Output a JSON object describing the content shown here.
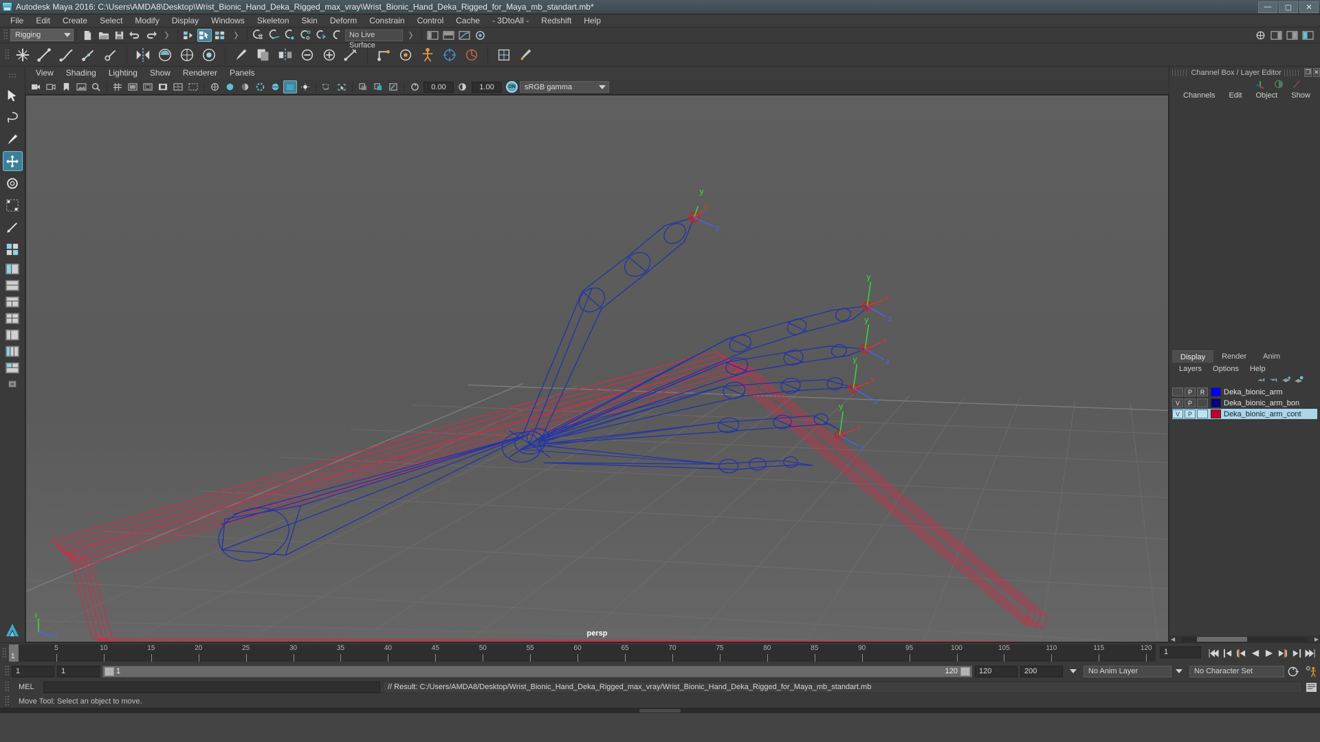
{
  "window": {
    "title": "Autodesk Maya 2016: C:\\Users\\AMDA8\\Desktop\\Wrist_Bionic_Hand_Deka_Rigged_max_vray\\Wrist_Bionic_Hand_Deka_Rigged_for_Maya_mb_standart.mb*",
    "minimize": "—",
    "maximize": "▢",
    "close": "✕"
  },
  "menubar": {
    "items": [
      {
        "label": "File"
      },
      {
        "label": "Edit"
      },
      {
        "label": "Create"
      },
      {
        "label": "Select"
      },
      {
        "label": "Modify"
      },
      {
        "label": "Display"
      },
      {
        "label": "Windows"
      },
      {
        "label": "Skeleton"
      },
      {
        "label": "Skin"
      },
      {
        "label": "Deform"
      },
      {
        "label": "Constrain"
      },
      {
        "label": "Control"
      },
      {
        "label": "Cache"
      },
      {
        "label": "- 3DtoAll -"
      },
      {
        "label": "Redshift"
      },
      {
        "label": "Help"
      }
    ]
  },
  "statusbar": {
    "menuset": "Rigging",
    "live_surface": "No Live Surface"
  },
  "viewport_menu": {
    "items": [
      {
        "label": "View"
      },
      {
        "label": "Shading"
      },
      {
        "label": "Lighting"
      },
      {
        "label": "Show"
      },
      {
        "label": "Renderer"
      },
      {
        "label": "Panels"
      }
    ]
  },
  "viewport_toolbar": {
    "exposure_value": "0.00",
    "gamma_value": "1.00",
    "color_mgmt_toggle": "ON",
    "color_profile": "sRGB gamma"
  },
  "viewport": {
    "camera_label": "persp",
    "axis_labels": {
      "x": "x",
      "y": "y",
      "z": "z"
    }
  },
  "right_panel": {
    "title": "Channel Box / Layer Editor",
    "restore_btn": "❐",
    "close_btn": "✕",
    "menu": [
      {
        "label": "Channels"
      },
      {
        "label": "Edit"
      },
      {
        "label": "Object"
      },
      {
        "label": "Show"
      }
    ],
    "tabs": [
      {
        "label": "Display",
        "active": true
      },
      {
        "label": "Render",
        "active": false
      },
      {
        "label": "Anim",
        "active": false
      }
    ],
    "layer_menu": [
      {
        "label": "Layers"
      },
      {
        "label": "Options"
      },
      {
        "label": "Help"
      }
    ],
    "layers": [
      {
        "visibility": "",
        "playback": "P",
        "mode": "R",
        "color": "#0000ff",
        "name": "Deka_bionic_arm",
        "selected": false
      },
      {
        "visibility": "V",
        "playback": "P",
        "mode": "",
        "color": "#00007e",
        "name": "Deka_bionic_arm_bon",
        "selected": false
      },
      {
        "visibility": "V",
        "playback": "P",
        "mode": "",
        "color": "#c2002e",
        "name": "Deka_bionic_arm_cont",
        "selected": true
      }
    ]
  },
  "timeline": {
    "current_frame": "1",
    "playback_field": "1",
    "ticks": [
      5,
      10,
      15,
      20,
      25,
      30,
      35,
      40,
      45,
      50,
      55,
      60,
      65,
      70,
      75,
      80,
      85,
      90,
      95,
      100,
      105,
      110,
      115,
      120
    ],
    "range_start": "1",
    "range_end": "1",
    "range_bar_start": "1",
    "range_bar_end": "120",
    "anim_start": "120",
    "anim_end": "200",
    "anim_layer": "No Anim Layer",
    "character_set": "No Character Set"
  },
  "mel": {
    "label": "MEL",
    "input_value": "",
    "result": "// Result: C:/Users/AMDA8/Desktop/Wrist_Bionic_Hand_Deka_Rigged_max_vray/Wrist_Bionic_Hand_Deka_Rigged_for_Maya_mb_standart.mb"
  },
  "helpline": {
    "text": "Move Tool: Select an object to move."
  },
  "colors": {
    "accent": "#5ea6bd",
    "selection_blue": "#a9d6e8",
    "control_red": "#c2002e",
    "bone_blue": "#00007e",
    "axis_x": "#ff3b3b",
    "axis_y": "#3bff3b",
    "axis_z": "#5b7bff"
  }
}
